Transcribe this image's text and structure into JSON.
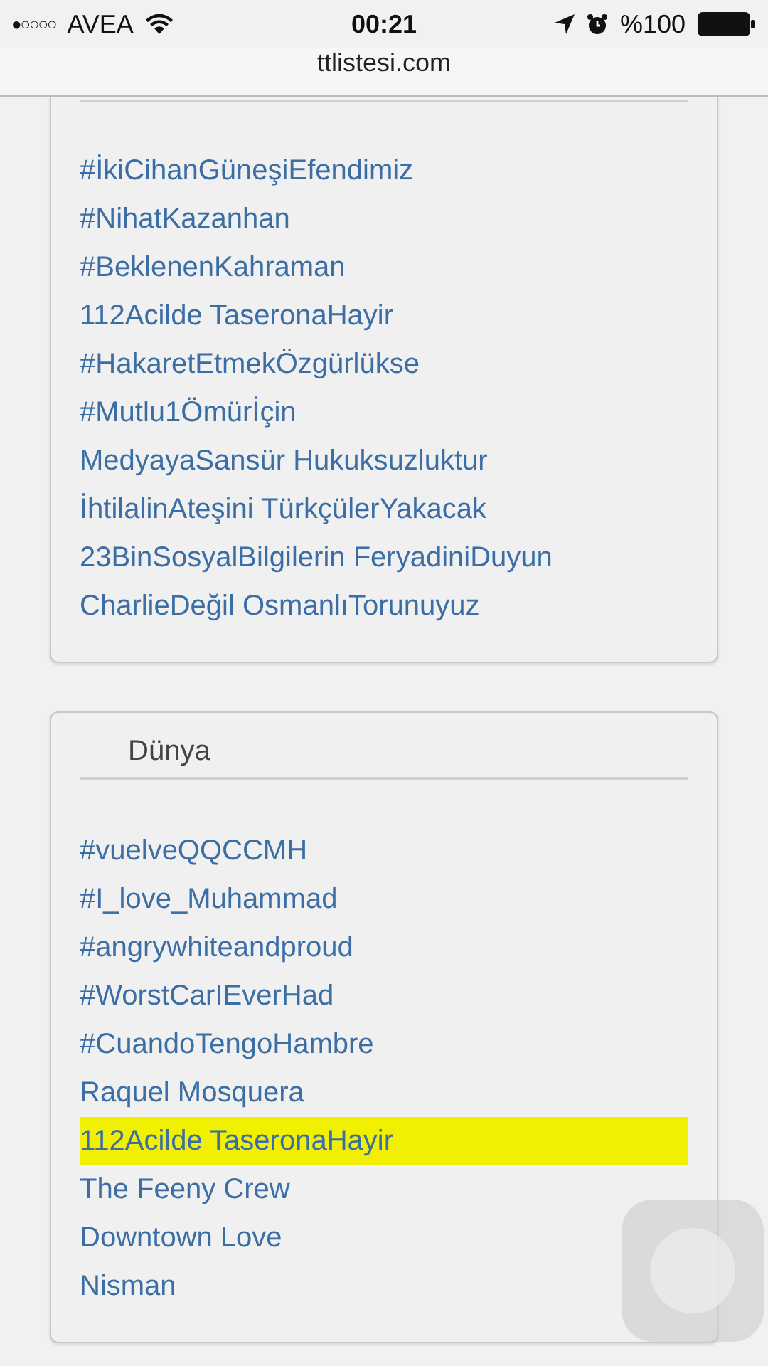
{
  "status_bar": {
    "carrier": "AVEA",
    "signal_dots": "●○○○○",
    "time": "00:21",
    "battery": "%100"
  },
  "address_bar": {
    "url": "ttlistesi.com"
  },
  "sections": [
    {
      "items": [
        {
          "text": "#İkiCihanGüneşiEfendimiz",
          "highlighted": false
        },
        {
          "text": "#NihatKazanhan",
          "highlighted": false
        },
        {
          "text": "#BeklenenKahraman",
          "highlighted": false
        },
        {
          "text": "112Acilde TaseronaHayir",
          "highlighted": false
        },
        {
          "text": "#HakaretEtmekÖzgürlükse",
          "highlighted": false
        },
        {
          "text": "#Mutlu1Ömürİçin",
          "highlighted": false
        },
        {
          "text": "MedyayaSansür Hukuksuzluktur",
          "highlighted": false
        },
        {
          "text": "İhtilalinAteşini TürkçülerYakacak",
          "highlighted": false
        },
        {
          "text": "23BinSosyalBilgilerin FeryadiniDuyun",
          "highlighted": false
        },
        {
          "text": "CharlieDeğil OsmanlıTorunuyuz",
          "highlighted": false
        }
      ]
    },
    {
      "title": "Dünya",
      "items": [
        {
          "text": "#vuelveQQCCMH",
          "highlighted": false
        },
        {
          "text": "#I_love_Muhammad",
          "highlighted": false
        },
        {
          "text": "#angrywhiteandproud",
          "highlighted": false
        },
        {
          "text": "#WorstCarIEverHad",
          "highlighted": false
        },
        {
          "text": "#CuandoTengoHambre",
          "highlighted": false
        },
        {
          "text": "Raquel Mosquera",
          "highlighted": false
        },
        {
          "text": "112Acilde TaseronaHayir",
          "highlighted": true
        },
        {
          "text": "The Feeny Crew",
          "highlighted": false
        },
        {
          "text": "Downtown Love",
          "highlighted": false
        },
        {
          "text": "Nisman",
          "highlighted": false
        }
      ]
    }
  ]
}
